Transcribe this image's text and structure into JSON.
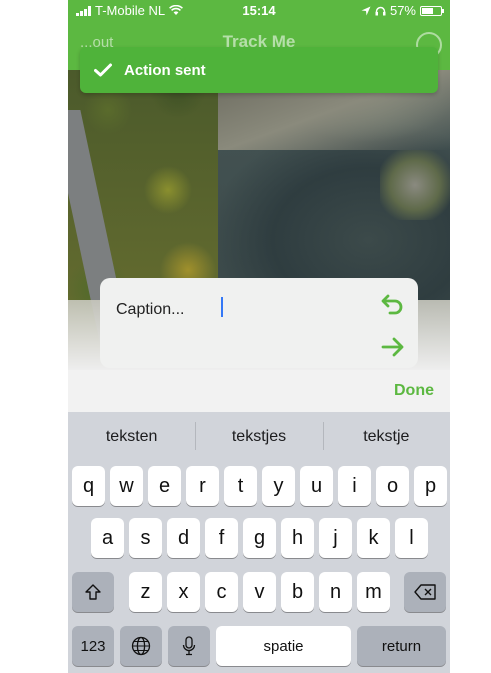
{
  "status_bar": {
    "carrier": "T-Mobile NL",
    "time": "15:14",
    "battery": "57%"
  },
  "header": {
    "left": "...out",
    "title": "Track Me"
  },
  "toast": {
    "message": "Action sent"
  },
  "caption": {
    "placeholder": "Caption..."
  },
  "accessory": {
    "done": "Done"
  },
  "keyboard": {
    "suggestions": [
      "teksten",
      "tekstjes",
      "tekstje"
    ],
    "row1": [
      "q",
      "w",
      "e",
      "r",
      "t",
      "y",
      "u",
      "i",
      "o",
      "p"
    ],
    "row2": [
      "a",
      "s",
      "d",
      "f",
      "g",
      "h",
      "j",
      "k",
      "l"
    ],
    "row3": [
      "z",
      "x",
      "c",
      "v",
      "b",
      "n",
      "m"
    ],
    "numbers_key": "123",
    "space_key": "spatie",
    "return_key": "return"
  },
  "colors": {
    "accent": "#5cb841",
    "toast": "#4fb33a"
  }
}
